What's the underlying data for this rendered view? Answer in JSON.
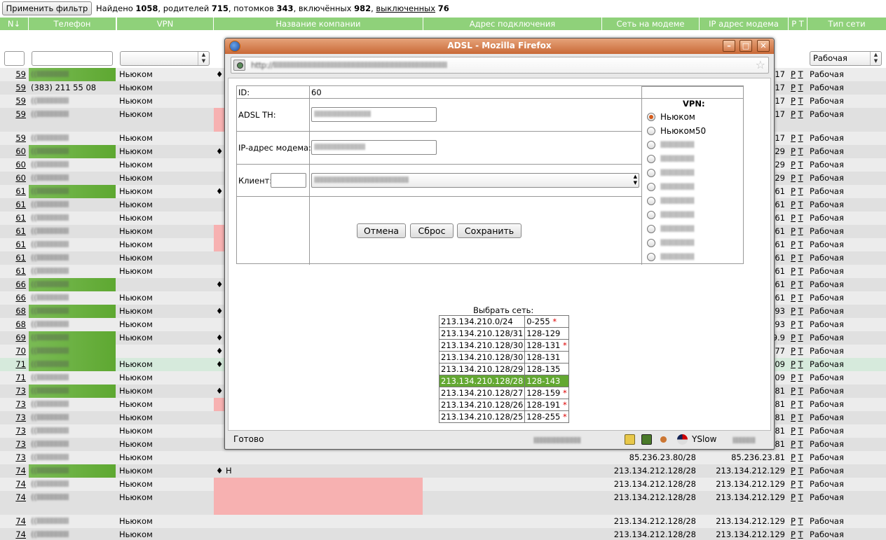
{
  "toolbar": {
    "apply_filter": "Применить фильтр",
    "found_label": "Найдено",
    "found": "1058",
    "parents_label": ", родителей",
    "parents": "715",
    "children_label": ", потомков",
    "children": "343",
    "included_label": ", включённых",
    "included": "982",
    "excluded_label": "выключенных",
    "excluded": "76"
  },
  "columns": {
    "id": "N↓",
    "phone": "Телефон",
    "vpn": "VPN",
    "company": "Название компании",
    "address": "Адрес подключения",
    "modem_net": "Сеть на модеме",
    "modem_ip": "IP адрес модема",
    "pt": "Р Т",
    "net_type": "Тип сети"
  },
  "filters": {
    "net_type_selected": "Рабочая"
  },
  "rows": [
    {
      "id": "59",
      "phone": "",
      "vpn": "Ньюком",
      "company": "♦",
      "net": "",
      "ip": "17",
      "pt_p": "Р",
      "pt_t": "Т",
      "type": "Рабочая",
      "green": true,
      "pink": false
    },
    {
      "id": "59",
      "phone": "(383) 211 55 08",
      "vpn": "Ньюком",
      "company": "",
      "net": "",
      "ip": "17",
      "pt_p": "Р",
      "pt_t": "Т",
      "type": "Рабочая",
      "green": false,
      "pink": false
    },
    {
      "id": "59",
      "phone": "",
      "vpn": "Ньюком",
      "company": "",
      "net": "",
      "ip": "17",
      "pt_p": "Р",
      "pt_t": "Т",
      "type": "Рабочая",
      "green": false,
      "pink": false
    },
    {
      "id": "59",
      "phone": "",
      "vpn": "Ньюком",
      "company": "",
      "net": "",
      "ip": "17",
      "pt_p": "Р",
      "pt_t": "Т",
      "type": "Рабочая",
      "green": false,
      "pink": true,
      "tall": true
    },
    {
      "id": "59",
      "phone": "",
      "vpn": "Ньюком",
      "company": "",
      "net": "",
      "ip": "17",
      "pt_p": "Р",
      "pt_t": "Т",
      "type": "Рабочая",
      "green": false,
      "pink": false
    },
    {
      "id": "60",
      "phone": "",
      "vpn": "Ньюком",
      "company": "♦",
      "net": "",
      "ip": "29",
      "pt_p": "Р",
      "pt_t": "Т",
      "type": "Рабочая",
      "green": true,
      "pink": false
    },
    {
      "id": "60",
      "phone": "",
      "vpn": "Ньюком",
      "company": "",
      "net": "",
      "ip": "29",
      "pt_p": "Р",
      "pt_t": "Т",
      "type": "Рабочая",
      "green": false,
      "pink": false
    },
    {
      "id": "60",
      "phone": "",
      "vpn": "Ньюком",
      "company": "",
      "net": "",
      "ip": "29",
      "pt_p": "Р",
      "pt_t": "Т",
      "type": "Рабочая",
      "green": false,
      "pink": false
    },
    {
      "id": "61",
      "phone": "",
      "vpn": "Ньюком",
      "company": "♦",
      "net": "",
      "ip": "61",
      "pt_p": "Р",
      "pt_t": "Т",
      "type": "Рабочая",
      "green": true,
      "pink": false
    },
    {
      "id": "61",
      "phone": "",
      "vpn": "Ньюком",
      "company": "",
      "net": "",
      "ip": "61",
      "pt_p": "Р",
      "pt_t": "Т",
      "type": "Рабочая",
      "green": false,
      "pink": false
    },
    {
      "id": "61",
      "phone": "",
      "vpn": "Ньюком",
      "company": "",
      "net": "",
      "ip": "61",
      "pt_p": "Р",
      "pt_t": "Т",
      "type": "Рабочая",
      "green": false,
      "pink": false
    },
    {
      "id": "61",
      "phone": "",
      "vpn": "Ньюком",
      "company": "",
      "net": "",
      "ip": "61",
      "pt_p": "Р",
      "pt_t": "Т",
      "type": "Рабочая",
      "green": false,
      "pink": true
    },
    {
      "id": "61",
      "phone": "",
      "vpn": "Ньюком",
      "company": "",
      "net": "",
      "ip": "61",
      "pt_p": "Р",
      "pt_t": "Т",
      "type": "Рабочая",
      "green": false,
      "pink": true
    },
    {
      "id": "61",
      "phone": "",
      "vpn": "Ньюком",
      "company": "",
      "net": "",
      "ip": "61",
      "pt_p": "Р",
      "pt_t": "Т",
      "type": "Рабочая",
      "green": false,
      "pink": false
    },
    {
      "id": "61",
      "phone": "",
      "vpn": "Ньюком",
      "company": "",
      "net": "",
      "ip": "61",
      "pt_p": "Р",
      "pt_t": "Т",
      "type": "Рабочая",
      "green": false,
      "pink": false
    },
    {
      "id": "66",
      "phone": "",
      "vpn": "",
      "company": "♦",
      "net": "",
      "ip": "61",
      "pt_p": "Р",
      "pt_t": "Т",
      "type": "Рабочая",
      "green": true,
      "pink": false
    },
    {
      "id": "66",
      "phone": "",
      "vpn": "Ньюком",
      "company": "",
      "net": "",
      "ip": "61",
      "pt_p": "Р",
      "pt_t": "Т",
      "type": "Рабочая",
      "green": false,
      "pink": false
    },
    {
      "id": "68",
      "phone": "",
      "vpn": "Ньюком",
      "company": "♦",
      "net": "",
      "ip": "93",
      "pt_p": "Р",
      "pt_t": "Т",
      "type": "Рабочая",
      "green": true,
      "pink": false
    },
    {
      "id": "68",
      "phone": "",
      "vpn": "Ньюком",
      "company": "",
      "net": "",
      "ip": "93",
      "pt_p": "Р",
      "pt_t": "Т",
      "type": "Рабочая",
      "green": false,
      "pink": false
    },
    {
      "id": "69",
      "phone": "",
      "vpn": "Ньюком",
      "company": "♦",
      "net": "",
      "ip": "9.9",
      "pt_p": "Р",
      "pt_t": "Т",
      "type": "Рабочая",
      "green": true,
      "pink": false
    },
    {
      "id": "70",
      "phone": "",
      "vpn": "",
      "company": "♦",
      "net": "",
      "ip": "77",
      "pt_p": "Р",
      "pt_t": "Т",
      "type": "Рабочая",
      "green": true,
      "pink": false
    },
    {
      "id": "71",
      "phone": "",
      "vpn": "Ньюком",
      "company": "♦",
      "net": "",
      "ip": "09",
      "pt_p": "Р",
      "pt_t": "Т",
      "type": "Рабочая",
      "green": true,
      "pink": false,
      "hl": true
    },
    {
      "id": "71",
      "phone": "",
      "vpn": "Ньюком",
      "company": "",
      "net": "",
      "ip": "09",
      "pt_p": "Р",
      "pt_t": "Т",
      "type": "Рабочая",
      "green": false,
      "pink": false
    },
    {
      "id": "73",
      "phone": "",
      "vpn": "Ньюком",
      "company": "♦",
      "net": "",
      "ip": "81",
      "pt_p": "Р",
      "pt_t": "Т",
      "type": "Рабочая",
      "green": true,
      "pink": false
    },
    {
      "id": "73",
      "phone": "",
      "vpn": "Ньюком",
      "company": "",
      "net": "",
      "ip": "81",
      "pt_p": "Р",
      "pt_t": "Т",
      "type": "Рабочая",
      "green": false,
      "pink": true
    },
    {
      "id": "73",
      "phone": "",
      "vpn": "Ньюком",
      "company": "",
      "net": "",
      "ip": "81",
      "pt_p": "Р",
      "pt_t": "Т",
      "type": "Рабочая",
      "green": false,
      "pink": false
    },
    {
      "id": "73",
      "phone": "",
      "vpn": "Ньюком",
      "company": "",
      "net": "",
      "ip": "81",
      "pt_p": "Р",
      "pt_t": "Т",
      "type": "Рабочая",
      "green": false,
      "pink": false
    },
    {
      "id": "73",
      "phone": "",
      "vpn": "Ньюком",
      "company": "",
      "net": "",
      "ip": "81",
      "pt_p": "Р",
      "pt_t": "Т",
      "type": "Рабочая",
      "green": false,
      "pink": false
    },
    {
      "id": "73",
      "phone": "",
      "vpn": "Ньюком",
      "company": "",
      "net": "85.236.23.80/28",
      "ip": "85.236.23.81",
      "pt_p": "Р",
      "pt_t": "Т",
      "type": "Рабочая",
      "green": false,
      "pink": false
    },
    {
      "id": "74",
      "phone": "",
      "vpn": "Ньюком",
      "company": "♦ Н",
      "net": "213.134.212.128/28",
      "ip": "213.134.212.129",
      "pt_p": "Р",
      "pt_t": "Т",
      "type": "Рабочая",
      "green": true,
      "pink": false
    },
    {
      "id": "74",
      "phone": "",
      "vpn": "Ньюком",
      "company": "",
      "net": "213.134.212.128/28",
      "ip": "213.134.212.129",
      "pt_p": "Р",
      "pt_t": "Т",
      "type": "Рабочая",
      "green": false,
      "pink": true
    },
    {
      "id": "74",
      "phone": "",
      "vpn": "Ньюком",
      "company": "",
      "net": "213.134.212.128/28",
      "ip": "213.134.212.129",
      "pt_p": "Р",
      "pt_t": "Т",
      "type": "Рабочая",
      "green": false,
      "pink": true,
      "tall": true
    },
    {
      "id": "74",
      "phone": "",
      "vpn": "Ньюком",
      "company": "",
      "net": "213.134.212.128/28",
      "ip": "213.134.212.129",
      "pt_p": "Р",
      "pt_t": "Т",
      "type": "Рабочая",
      "green": false,
      "pink": false
    },
    {
      "id": "74",
      "phone": "",
      "vpn": "Ньюком",
      "company": "",
      "net": "213.134.212.128/28",
      "ip": "213.134.212.129",
      "pt_p": "Р",
      "pt_t": "Т",
      "type": "Рабочая",
      "green": false,
      "pink": false
    }
  ],
  "popup": {
    "title": "ADSL - Mozilla Firefox",
    "minimize": "–",
    "maximize": "□",
    "close": "✕",
    "form": {
      "id_label": "ID:",
      "id_value": "60",
      "adsl_label": "ADSL TH:",
      "ip_label": "IP-адрес модема:",
      "client_label": "Клиент:",
      "cancel": "Отмена",
      "reset": "Сброс",
      "save": "Сохранить",
      "vpn_title": "VPN:",
      "vpn_options": [
        "Ньюком",
        "Ньюком50"
      ],
      "vpn_selected": "Ньюком"
    },
    "networks_title": "Выбрать сеть:",
    "networks": [
      {
        "net": "213.134.210.0/24",
        "range": "0-255",
        "star": true,
        "selected": false
      },
      {
        "net": "213.134.210.128/31",
        "range": "128-129",
        "star": false,
        "selected": false
      },
      {
        "net": "213.134.210.128/30",
        "range": "128-131",
        "star": true,
        "selected": false
      },
      {
        "net": "213.134.210.128/30",
        "range": "128-131",
        "star": false,
        "selected": false
      },
      {
        "net": "213.134.210.128/29",
        "range": "128-135",
        "star": false,
        "selected": false
      },
      {
        "net": "213.134.210.128/28",
        "range": "128-143",
        "star": false,
        "selected": true
      },
      {
        "net": "213.134.210.128/27",
        "range": "128-159",
        "star": true,
        "selected": false
      },
      {
        "net": "213.134.210.128/26",
        "range": "128-191",
        "star": true,
        "selected": false
      },
      {
        "net": "213.134.210.128/25",
        "range": "128-255",
        "star": true,
        "selected": false
      }
    ],
    "status": "Готово",
    "yslow": "YSlow"
  },
  "colors": {
    "header": "#8fd17a",
    "green": "#5ea831",
    "pink": "#f7b1b1",
    "titlebar": "#c96937",
    "selected_net": "#63a832"
  }
}
